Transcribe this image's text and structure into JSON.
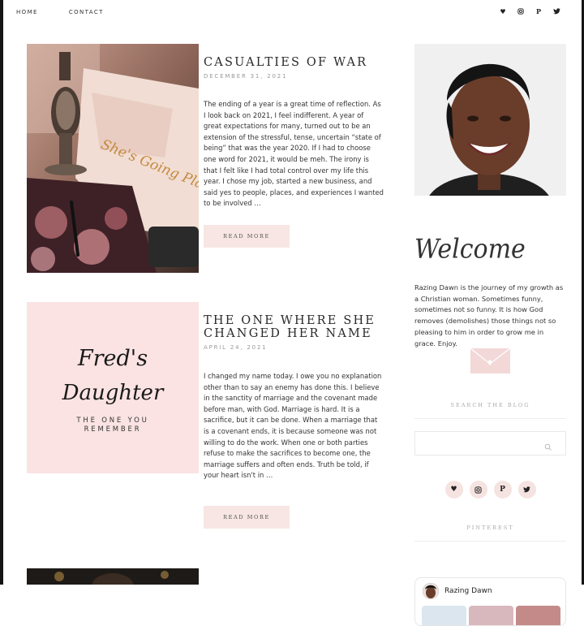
{
  "nav": {
    "items": [
      "HOME",
      "CONTACT"
    ]
  },
  "social": [
    "heart-icon",
    "instagram-icon",
    "pinterest-icon",
    "twitter-icon"
  ],
  "posts": [
    {
      "title": "CASUALTIES OF WAR",
      "date": "DECEMBER 31, 2021",
      "excerpt": " The ending of a year is a great time of reflection. As I look back on 2021, I feel indifferent. A year of great expectations for many, turned out to be an extension of the stressful, tense, uncertain “state of being” that was the year 2020. If I had to choose one word for 2021, it would be meh. The irony is that I felt like I had total control over my life this year. I chose my job, started a new business, and said yes to people, places, and experiences I wanted to be involved …",
      "read_more": "READ MORE",
      "image_text": "She's Going Places"
    },
    {
      "title": "THE ONE WHERE SHE CHANGED HER NAME",
      "date": "APRIL 24, 2021",
      "excerpt": "I changed my name today. I owe you no explanation other than to say an enemy has done this. I believe in the sanctity of marriage and the covenant made before man, with God. Marriage is hard. It is a sacrifice, but it can be done. When a marriage that is a covenant ends, it is because someone was not willing to do the work. When one or both parties refuse to make the sacrifices to become one, the marriage suffers and often ends.  Truth be told, if your heart isn't in …",
      "read_more": "READ MORE",
      "image_line1": "Fred's",
      "image_line2": "Daughter",
      "image_sub1": "THE ONE YOU",
      "image_sub2": "REMEMBER"
    }
  ],
  "sidebar": {
    "welcome": "Welcome",
    "about": "Razing Dawn is the journey of my growth as a Christian woman. Sometimes funny, sometimes not so funny. It is how God removes (demolishes) those things not so pleasing to him in order to grow me in grace. Enjoy.",
    "search_heading": "SEARCH THE BLOG",
    "search_placeholder": "",
    "pinterest_heading": "PINTEREST",
    "pinterest_name": "Razing Dawn"
  },
  "colors": {
    "accent_pink": "#f7e6e4",
    "social_bg": "#f5e3e1"
  }
}
